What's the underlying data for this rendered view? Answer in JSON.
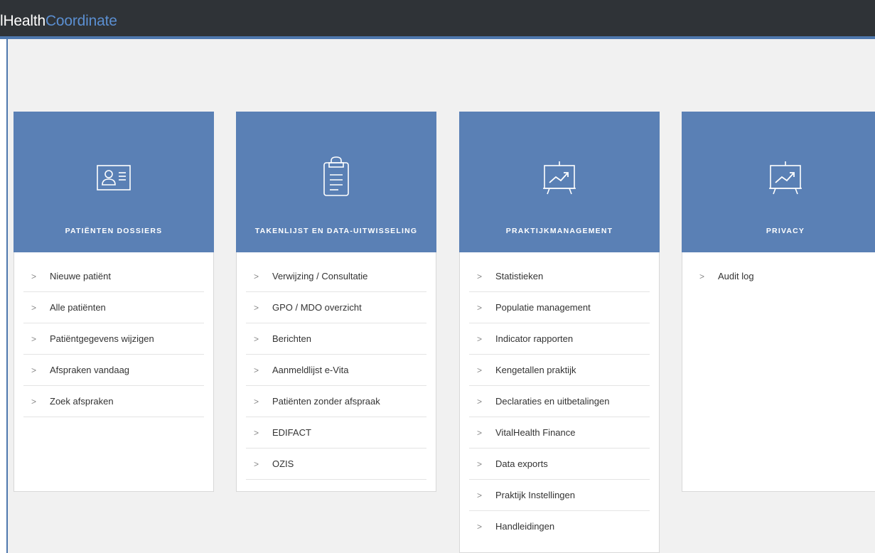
{
  "brand": {
    "part1": "lHealth",
    "part2": "Coordinate"
  },
  "cards": [
    {
      "title": "PATIËNTEN DOSSIERS",
      "icon": "patient-id-card-icon",
      "items": [
        "Nieuwe patiënt",
        "Alle patiënten",
        "Patiëntgegevens wijzigen",
        "Afspraken vandaag",
        "Zoek afspraken"
      ]
    },
    {
      "title": "TAKENLIJST EN DATA-UITWISSELING",
      "icon": "clipboard-icon",
      "items": [
        "Verwijzing / Consultatie",
        "GPO / MDO overzicht",
        "Berichten",
        "Aanmeldlijst e-Vita",
        "Patiënten zonder afspraak",
        "EDIFACT",
        "OZIS"
      ]
    },
    {
      "title": "PRAKTIJKMANAGEMENT",
      "icon": "presentation-chart-icon",
      "items": [
        "Statistieken",
        "Populatie management",
        "Indicator rapporten",
        "Kengetallen praktijk",
        "Declaraties en uitbetalingen",
        "VitalHealth Finance",
        "Data exports",
        "Praktijk Instellingen",
        "Handleidingen"
      ]
    },
    {
      "title": "PRIVACY",
      "icon": "presentation-chart-icon",
      "items": [
        "Audit log"
      ]
    }
  ],
  "chevron": ">",
  "colors": {
    "header_bg": "#2f3337",
    "accent": "#4e78ae",
    "card_head": "#5a80b5",
    "brand_highlight": "#5b8fd1"
  }
}
